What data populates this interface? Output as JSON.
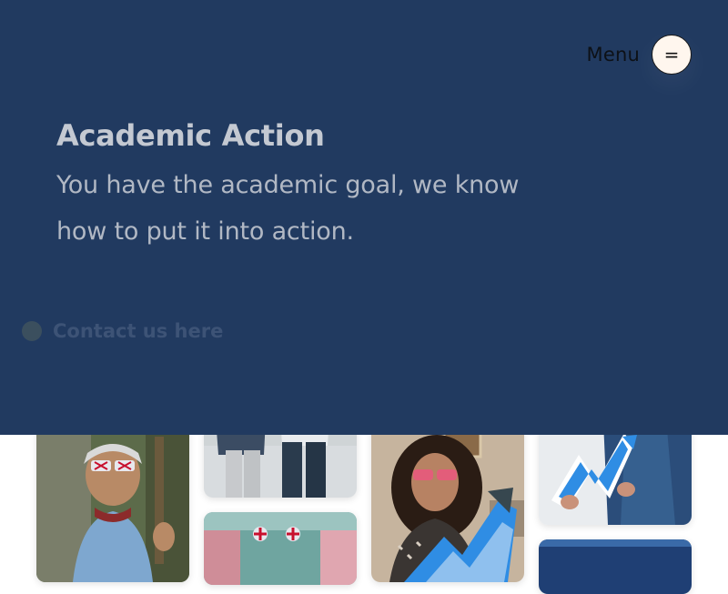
{
  "header": {
    "menu_label": "Menu",
    "menu_icon": "hamburger-icon",
    "menu_glyph": "="
  },
  "hero": {
    "title": "Academic Action",
    "subtitle": "You have the academic goal, we know how to put it into action.",
    "contact_label": "Contact us here"
  },
  "gallery": {
    "photos": [
      {
        "subject": "man-with-sunglasses-thumbs-up"
      },
      {
        "subject": "two-people-standing"
      },
      {
        "subject": "building-with-flags"
      },
      {
        "subject": "woman-with-logo-sign"
      },
      {
        "subject": "person-holding-logo"
      },
      {
        "subject": "blue-photo-partial"
      }
    ]
  },
  "colors": {
    "hero_bg": "#213a60",
    "title": "#c4c9d2",
    "subtitle": "#b1b8c4",
    "contact_text": "#3d5376",
    "menu_button_bg": "#fff6ee",
    "brand_blue": "#2f8de4"
  }
}
